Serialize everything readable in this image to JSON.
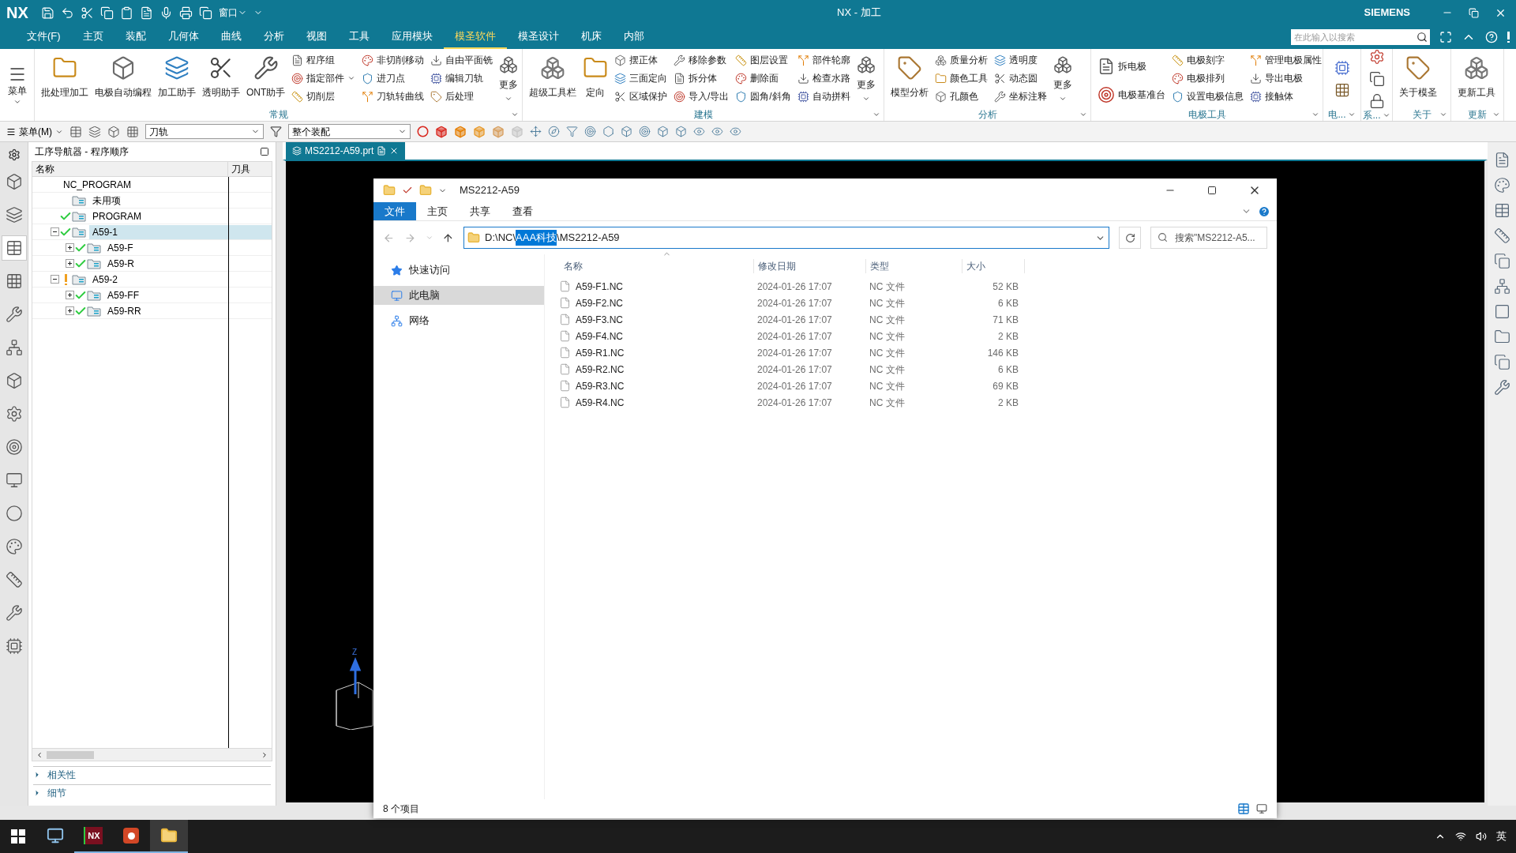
{
  "title_bar": {
    "logo": "NX",
    "window_menu": "窗口",
    "title": "NX - 加工",
    "brand": "SIEMENS"
  },
  "menu_tabs": [
    {
      "label": "文件(F)",
      "selected": false
    },
    {
      "label": "主页",
      "selected": false
    },
    {
      "label": "装配",
      "selected": false
    },
    {
      "label": "几何体",
      "selected": false
    },
    {
      "label": "曲线",
      "selected": false
    },
    {
      "label": "分析",
      "selected": false
    },
    {
      "label": "视图",
      "selected": false
    },
    {
      "label": "工具",
      "selected": false
    },
    {
      "label": "应用模块",
      "selected": false
    },
    {
      "label": "模圣软件",
      "selected": true
    },
    {
      "label": "模圣设计",
      "selected": false
    },
    {
      "label": "机床",
      "selected": false
    },
    {
      "label": "内部",
      "selected": false
    }
  ],
  "search": {
    "placeholder": "在此输入以搜索"
  },
  "ribbon": {
    "menu_button": "菜单",
    "groups": [
      {
        "kind": "tools",
        "title": "常规",
        "large": [
          {
            "label": "批处理加工"
          },
          {
            "label": "电极自动编程"
          },
          {
            "label": "加工助手"
          },
          {
            "label": "透明助手"
          },
          {
            "label": "ONT助手"
          }
        ],
        "columns": [
          [
            {
              "label": "程序组"
            },
            {
              "label": "指定部件",
              "dropdown": true
            },
            {
              "label": "切削层"
            }
          ],
          [
            {
              "label": "非切削移动"
            },
            {
              "label": "进刀点"
            },
            {
              "label": "刀轨转曲线"
            }
          ],
          [
            {
              "label": "自由平面铣"
            },
            {
              "label": "编辑刀轨"
            },
            {
              "label": "后处理"
            }
          ]
        ],
        "more": "更多"
      },
      {
        "kind": "tools",
        "title": "建模",
        "large": [
          {
            "label": "超级工具栏"
          },
          {
            "label": "定向"
          }
        ],
        "columns": [
          [
            {
              "label": "摆正体"
            },
            {
              "label": "三面定向"
            },
            {
              "label": "区域保护"
            }
          ],
          [
            {
              "label": "移除参数"
            },
            {
              "label": "拆分体"
            },
            {
              "label": "导入/导出"
            }
          ],
          [
            {
              "label": "图层设置"
            },
            {
              "label": "删除面"
            },
            {
              "label": "圆角/斜角"
            }
          ],
          [
            {
              "label": "部件轮廓"
            },
            {
              "label": "检查水路"
            },
            {
              "label": "自动拼料"
            }
          ]
        ],
        "more": "更多"
      },
      {
        "kind": "tools",
        "title": "分析",
        "large": [
          {
            "label": "模型分析"
          }
        ],
        "columns": [
          [
            {
              "label": "质量分析"
            },
            {
              "label": "颜色工具"
            },
            {
              "label": "孔颜色"
            }
          ],
          [
            {
              "label": "透明度"
            },
            {
              "label": "动态圆"
            },
            {
              "label": "坐标注释"
            }
          ]
        ],
        "more": "更多"
      },
      {
        "kind": "tools",
        "title": "电极工具",
        "columns": [
          [
            {
              "label": "拆电极"
            },
            {
              "label": "电极基准台"
            }
          ],
          [
            {
              "label": "电极刻字"
            },
            {
              "label": "电极排列"
            },
            {
              "label": "设置电极信息"
            }
          ],
          [
            {
              "label": "管理电极属性"
            },
            {
              "label": "导出电极"
            },
            {
              "label": "接触体"
            }
          ]
        ]
      },
      {
        "kind": "icons",
        "title": "电..."
      },
      {
        "kind": "icons",
        "title": "系..."
      },
      {
        "kind": "tools",
        "title": "关于",
        "large": [
          {
            "label": "关于模圣"
          }
        ]
      },
      {
        "kind": "tools",
        "title": "更新",
        "large": [
          {
            "label": "更新工具"
          }
        ]
      }
    ]
  },
  "toolbar": {
    "menu_label": "菜单(M)",
    "type_filter": "刀轨",
    "scope": "整个装配"
  },
  "left_tabs": [
    {
      "selected": false
    },
    {
      "selected": false
    },
    {
      "selected": true
    },
    {
      "selected": false
    },
    {
      "selected": false
    },
    {
      "selected": false
    },
    {
      "selected": false
    },
    {
      "selected": false
    },
    {
      "selected": false
    },
    {
      "selected": false
    },
    {
      "selected": false
    },
    {
      "selected": false
    },
    {
      "selected": false
    },
    {
      "selected": false
    },
    {
      "selected": false
    }
  ],
  "navigator": {
    "title": "工序导航器 - 程序顺序",
    "columns": [
      "名称",
      "刀具"
    ],
    "tree": [
      {
        "label": "NC_PROGRAM",
        "complete": false,
        "warning": false,
        "selected": false,
        "children": [
          {
            "label": "未用项",
            "complete": false,
            "warning": false,
            "selected": false
          },
          {
            "label": "PROGRAM",
            "complete": true,
            "warning": false,
            "selected": false
          },
          {
            "label": "A59-1",
            "complete": true,
            "warning": false,
            "expanded": true,
            "selected": true,
            "children": [
              {
                "label": "A59-F",
                "complete": true,
                "warning": false,
                "expanded": false,
                "selected": false
              },
              {
                "label": "A59-R",
                "complete": true,
                "warning": false,
                "expanded": false,
                "selected": false
              }
            ]
          },
          {
            "label": "A59-2",
            "complete": false,
            "warning": true,
            "expanded": true,
            "selected": false,
            "children": [
              {
                "label": "A59-FF",
                "complete": true,
                "warning": false,
                "expanded": false,
                "selected": false
              },
              {
                "label": "A59-RR",
                "complete": true,
                "warning": false,
                "expanded": false,
                "selected": false
              }
            ]
          }
        ]
      }
    ],
    "sections": [
      {
        "label": "相关性",
        "expanded": false
      },
      {
        "label": "细节",
        "expanded": false
      }
    ]
  },
  "graphics_tab": {
    "label": "MS2212-A59.prt",
    "selected": true
  },
  "triad": {
    "label": "Z"
  },
  "explorer": {
    "title": "MS2212-A59",
    "ribbon_tabs": [
      {
        "label": "文件",
        "selected": true
      },
      {
        "label": "主页",
        "selected": false
      },
      {
        "label": "共享",
        "selected": false
      },
      {
        "label": "查看",
        "selected": false
      }
    ],
    "address": [
      {
        "text": "D:\\NC\\",
        "selected": false
      },
      {
        "text": "AAA科技",
        "selected": true
      },
      {
        "text": "\\MS2212-A59",
        "selected": false
      }
    ],
    "search": {
      "placeholder": "搜索\"MS2212-A5..."
    },
    "nav": [
      {
        "label": "快速访问",
        "selected": false
      },
      {
        "label": "此电脑",
        "selected": true
      },
      {
        "label": "网络",
        "selected": false
      }
    ],
    "columns": [
      "名称",
      "修改日期",
      "类型",
      "大小"
    ],
    "files": [
      {
        "name": "A59-F1.NC",
        "modified": "2024-01-26 17:07",
        "type": "NC 文件",
        "size": "52 KB"
      },
      {
        "name": "A59-F2.NC",
        "modified": "2024-01-26 17:07",
        "type": "NC 文件",
        "size": "6 KB"
      },
      {
        "name": "A59-F3.NC",
        "modified": "2024-01-26 17:07",
        "type": "NC 文件",
        "size": "71 KB"
      },
      {
        "name": "A59-F4.NC",
        "modified": "2024-01-26 17:07",
        "type": "NC 文件",
        "size": "2 KB"
      },
      {
        "name": "A59-R1.NC",
        "modified": "2024-01-26 17:07",
        "type": "NC 文件",
        "size": "146 KB"
      },
      {
        "name": "A59-R2.NC",
        "modified": "2024-01-26 17:07",
        "type": "NC 文件",
        "size": "6 KB"
      },
      {
        "name": "A59-R3.NC",
        "modified": "2024-01-26 17:07",
        "type": "NC 文件",
        "size": "69 KB"
      },
      {
        "name": "A59-R4.NC",
        "modified": "2024-01-26 17:07",
        "type": "NC 文件",
        "size": "2 KB"
      }
    ],
    "status": "8 个项目"
  },
  "taskbar": {
    "apps": [
      {
        "kind": "desktop",
        "running": false,
        "active": false
      },
      {
        "kind": "nx",
        "label": "NX",
        "running": true,
        "active": false
      },
      {
        "kind": "slides",
        "running": true,
        "active": false
      },
      {
        "kind": "folder",
        "running": true,
        "active": true
      }
    ],
    "ime": "英"
  }
}
